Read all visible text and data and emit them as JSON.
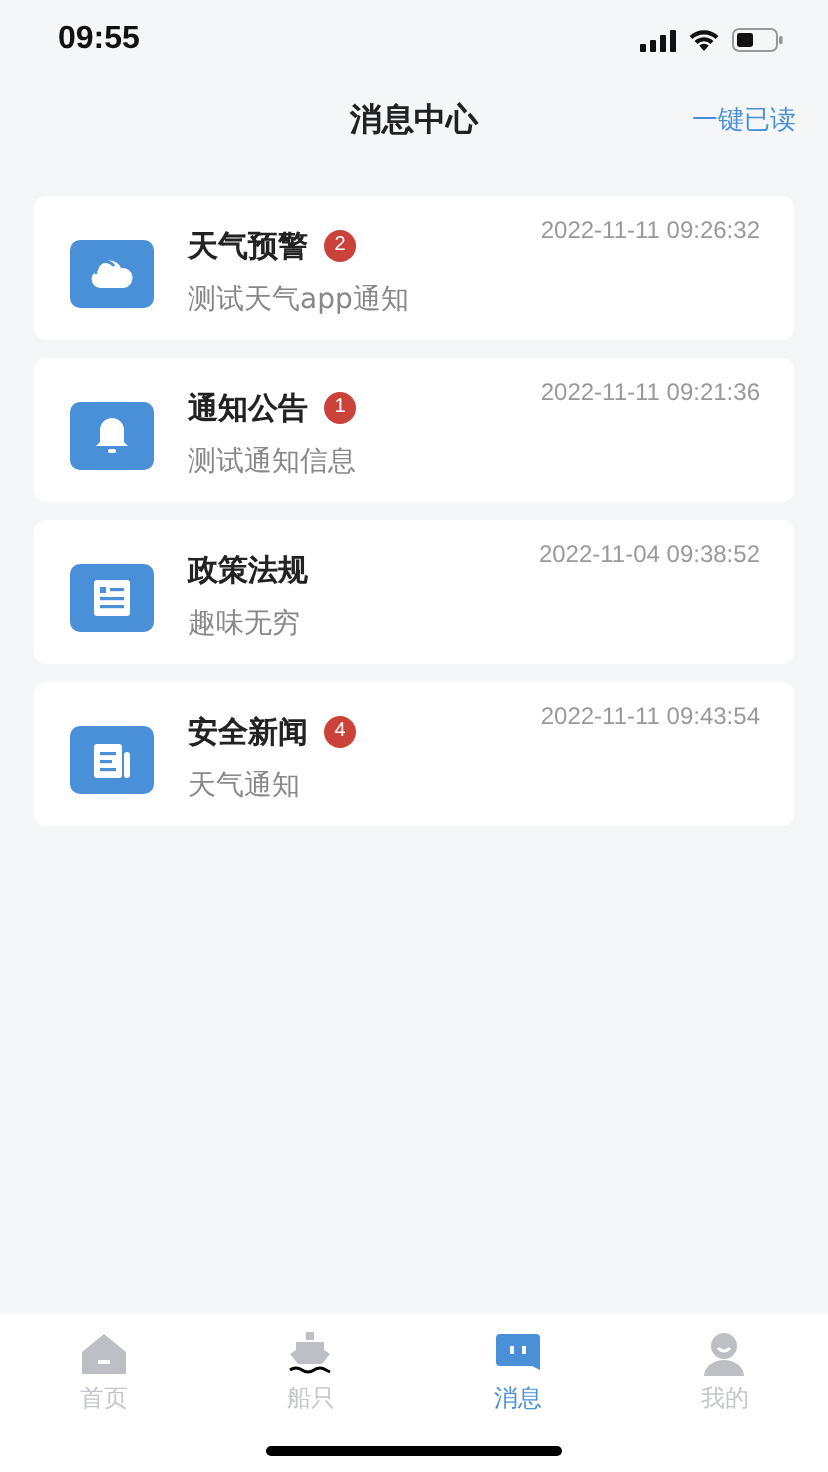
{
  "status_bar": {
    "time": "09:55"
  },
  "header": {
    "title": "消息中心",
    "action": "一键已读"
  },
  "messages": [
    {
      "kind": "weather",
      "title": "天气预警",
      "badge": "2",
      "time": "2022-11-11 09:26:32",
      "preview": "测试天气app通知"
    },
    {
      "kind": "notice",
      "title": "通知公告",
      "badge": "1",
      "time": "2022-11-11 09:21:36",
      "preview": "测试通知信息"
    },
    {
      "kind": "policy",
      "title": "政策法规",
      "time": "2022-11-04 09:38:52",
      "preview": "趣味无穷"
    },
    {
      "kind": "news",
      "title": "安全新闻",
      "badge": "4",
      "time": "2022-11-11 09:43:54",
      "preview": "天气通知"
    }
  ],
  "tab_bar": [
    {
      "kind": "home",
      "label": "首页",
      "selected": false
    },
    {
      "kind": "ships",
      "label": "船只",
      "selected": false
    },
    {
      "kind": "messages",
      "label": "消息",
      "selected": true
    },
    {
      "kind": "profile",
      "label": "我的",
      "selected": false
    }
  ]
}
